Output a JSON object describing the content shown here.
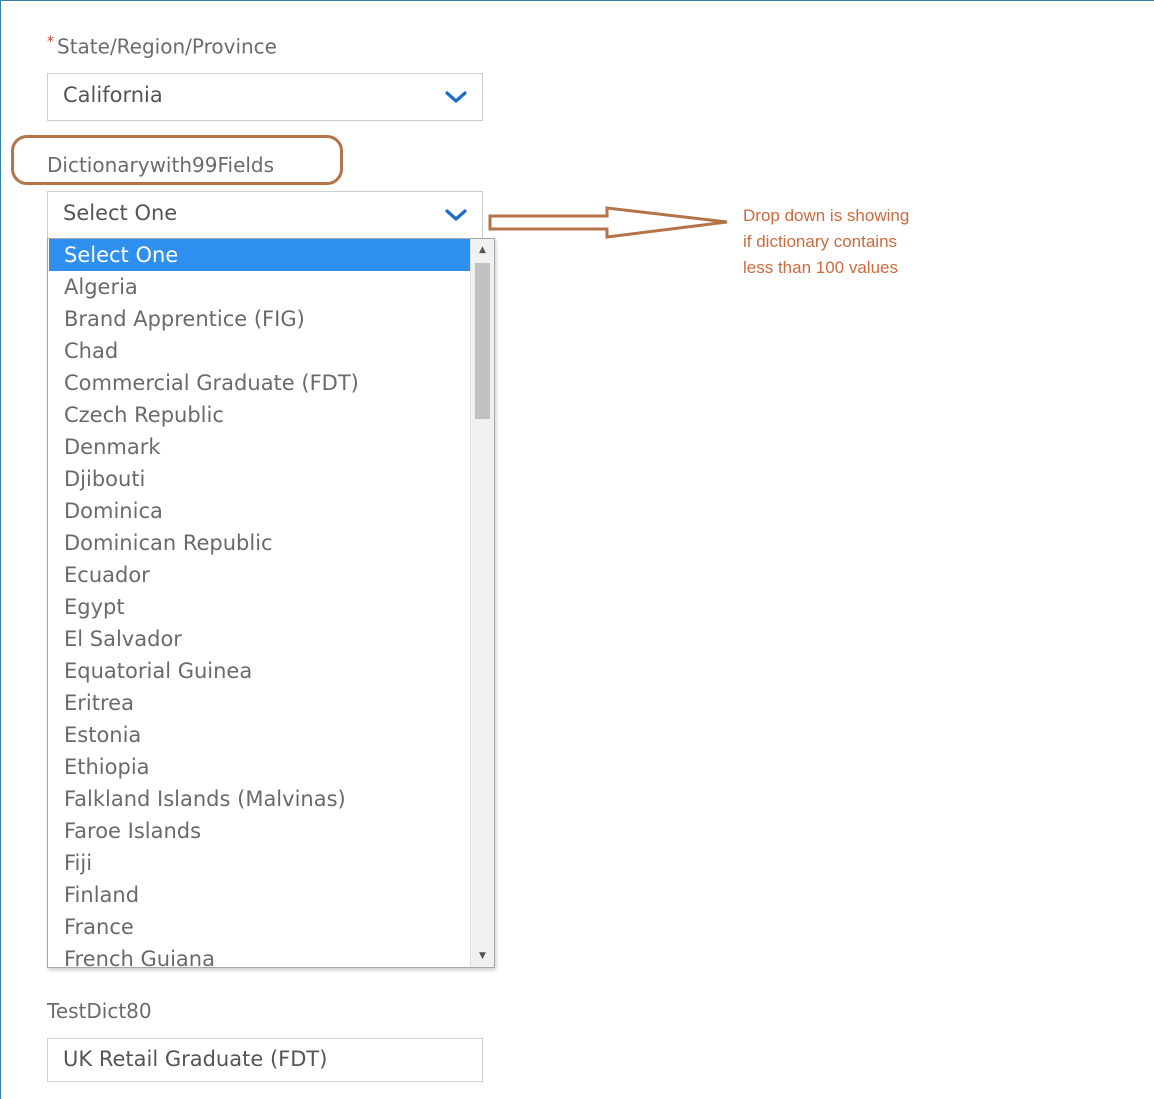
{
  "state_field": {
    "required_marker": "*",
    "label": "State/Region/Province",
    "value": "California"
  },
  "dict_field": {
    "label": "Dictionarywith99Fields",
    "value": "Select One",
    "options": [
      "Select One",
      "Algeria",
      "Brand Apprentice (FIG)",
      "Chad",
      "Commercial Graduate (FDT)",
      "Czech Republic",
      "Denmark",
      "Djibouti",
      "Dominica",
      "Dominican Republic",
      "Ecuador",
      "Egypt",
      "El Salvador",
      "Equatorial Guinea",
      "Eritrea",
      "Estonia",
      "Ethiopia",
      "Falkland Islands (Malvinas)",
      "Faroe Islands",
      "Fiji",
      "Finland",
      "France",
      "French Guiana"
    ],
    "selected_index": 0,
    "scroll_position": 0.0
  },
  "test_field": {
    "label": "TestDict80",
    "value": "UK Retail Graduate (FDT)"
  },
  "annotation": {
    "lines": [
      "Drop down is showing",
      "if dictionary contains",
      "less than 100 values"
    ],
    "color": "#cc6b3e",
    "outline_color": "#b5734a"
  },
  "colors": {
    "chevron": "#1a6fc2",
    "selected_option_bg": "#2f8fef"
  }
}
